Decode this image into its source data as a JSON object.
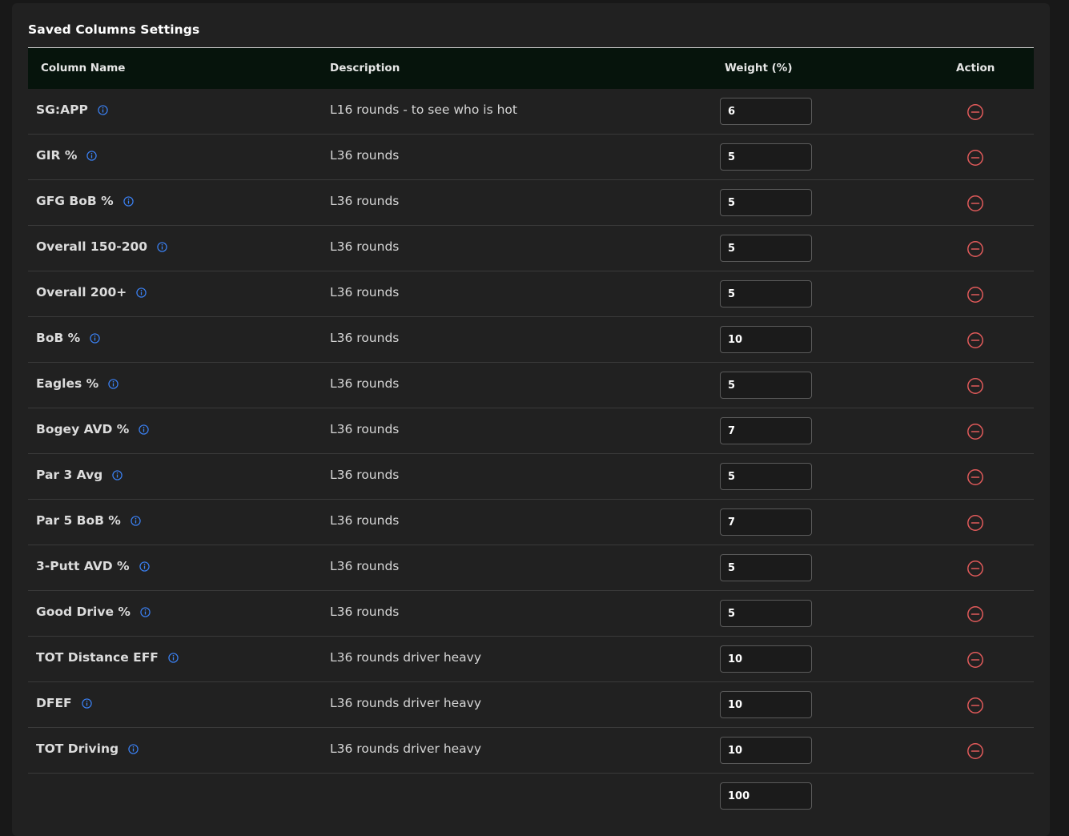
{
  "panel": {
    "title": "Saved Columns Settings"
  },
  "table": {
    "headers": {
      "column_name": "Column Name",
      "description": "Description",
      "weight": "Weight (%)",
      "action": "Action"
    },
    "rows": [
      {
        "name": "SG:APP",
        "description": "L16 rounds - to see who is hot",
        "weight": "6"
      },
      {
        "name": "GIR %",
        "description": "L36 rounds",
        "weight": "5"
      },
      {
        "name": "GFG BoB %",
        "description": "L36 rounds",
        "weight": "5"
      },
      {
        "name": "Overall 150-200",
        "description": "L36 rounds",
        "weight": "5"
      },
      {
        "name": "Overall 200+",
        "description": "L36 rounds",
        "weight": "5"
      },
      {
        "name": "BoB %",
        "description": "L36 rounds",
        "weight": "10"
      },
      {
        "name": "Eagles %",
        "description": "L36 rounds",
        "weight": "5"
      },
      {
        "name": "Bogey AVD %",
        "description": "L36 rounds",
        "weight": "7"
      },
      {
        "name": "Par 3 Avg",
        "description": "L36 rounds",
        "weight": "5"
      },
      {
        "name": "Par 5 BoB %",
        "description": "L36 rounds",
        "weight": "7"
      },
      {
        "name": "3-Putt AVD %",
        "description": "L36 rounds",
        "weight": "5"
      },
      {
        "name": "Good Drive %",
        "description": "L36 rounds",
        "weight": "5"
      },
      {
        "name": "TOT Distance EFF",
        "description": "L36 rounds driver heavy",
        "weight": "10"
      },
      {
        "name": "DFEF",
        "description": "L36 rounds driver heavy",
        "weight": "10"
      },
      {
        "name": "TOT Driving",
        "description": "L36 rounds driver heavy",
        "weight": "10"
      }
    ],
    "total_weight": "100"
  },
  "icons": {
    "info": "info-circle-icon",
    "remove": "minus-circle-icon"
  },
  "colors": {
    "header_bg": "#06140c",
    "info_icon": "#3b82f6",
    "remove_icon": "#e05a5a",
    "panel_bg": "#212121"
  }
}
